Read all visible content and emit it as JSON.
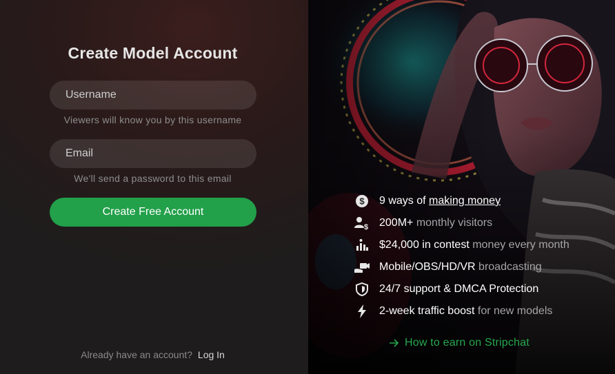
{
  "form": {
    "title": "Create Model Account",
    "username_placeholder": "Username",
    "username_hint": "Viewers will know you by this username",
    "email_placeholder": "Email",
    "email_hint": "We'll send a password to this email",
    "submit_label": "Create Free Account",
    "login_prompt": "Already have an account?",
    "login_link": "Log In"
  },
  "benefits": [
    {
      "icon": "dollar-coin-icon",
      "lead": "9 ways of ",
      "link": "making money",
      "rest": ""
    },
    {
      "icon": "users-dollar-icon",
      "lead": "200M+",
      "rest": " monthly visitors"
    },
    {
      "icon": "trophy-chart-icon",
      "lead": "$24,000 in contest",
      "rest": " money every month"
    },
    {
      "icon": "camera-hand-icon",
      "lead": "Mobile/OBS/HD/VR",
      "rest": " broadcasting"
    },
    {
      "icon": "shield-icon",
      "lead": "24/7 support & DMCA Protection",
      "rest": ""
    },
    {
      "icon": "lightning-icon",
      "lead": "2-week traffic boost",
      "rest": " for new models"
    }
  ],
  "earn_link": "How to earn on Stripchat",
  "colors": {
    "accent_green": "#22a04a",
    "link_green": "#27a84f"
  }
}
